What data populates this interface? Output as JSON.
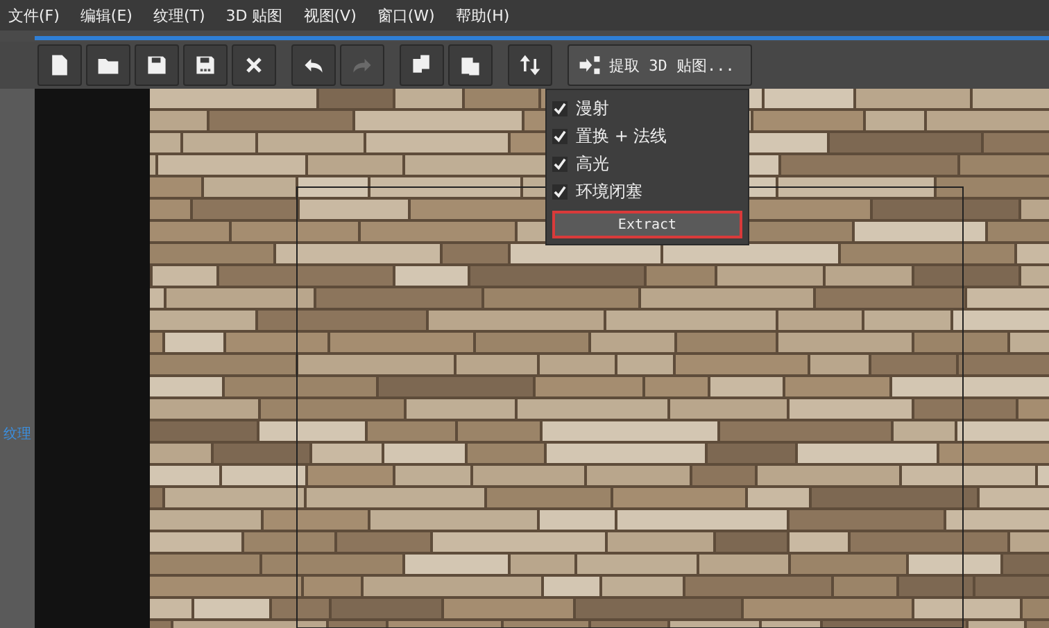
{
  "menu_bar": [
    "文件(F)",
    "编辑(E)",
    "纹理(T)",
    "3D 贴图",
    "视图(V)",
    "窗口(W)",
    "帮助(H)"
  ],
  "toolbar": [
    {
      "kind": "new",
      "disabled": false
    },
    {
      "kind": "open",
      "disabled": false
    },
    {
      "kind": "save",
      "disabled": false
    },
    {
      "kind": "save_as",
      "disabled": false
    },
    {
      "kind": "close",
      "disabled": false
    },
    {
      "kind": "undo",
      "disabled": false
    },
    {
      "kind": "redo",
      "disabled": true
    },
    {
      "kind": "copy",
      "disabled": false
    },
    {
      "kind": "paste",
      "disabled": false
    },
    {
      "kind": "swap",
      "disabled": false
    }
  ],
  "extract_menu": {
    "label": "提取 3D 贴图...",
    "expanded": true,
    "options": [
      {
        "label": "漫射",
        "checked": true
      },
      {
        "label": "置换 + 法线",
        "checked": true
      },
      {
        "label": "高光",
        "checked": true
      },
      {
        "label": "环境闭塞",
        "checked": true
      }
    ],
    "extract_button": {
      "label": "Extract",
      "highlighted": true
    }
  },
  "side_panel": {
    "label": "纹理"
  }
}
